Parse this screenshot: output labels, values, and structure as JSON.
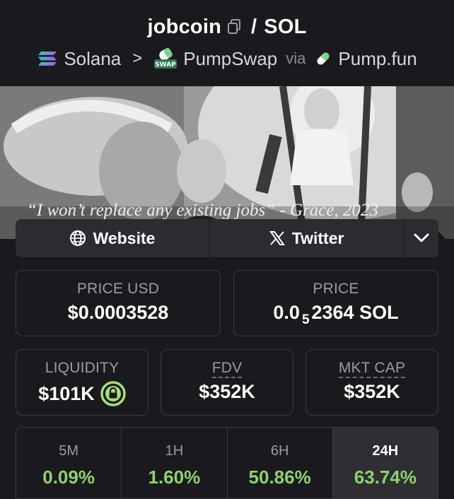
{
  "header": {
    "token": "jobcoin",
    "separator": "/",
    "quote": "SOL",
    "chain": "Solana",
    "chevron": ">",
    "dex": "PumpSwap",
    "dex_badge": "SWAP",
    "via": "via",
    "launchpad": "Pump.fun"
  },
  "banner": {
    "caption": "“I won’t replace any existing jobs” - Grace, 2023"
  },
  "links": {
    "website": "Website",
    "twitter": "Twitter"
  },
  "price_usd": {
    "label": "PRICE USD",
    "value": "$0.0003528"
  },
  "price_native": {
    "label": "PRICE",
    "prefix": "0.0",
    "subscript": "5",
    "suffix": "2364 SOL"
  },
  "liquidity": {
    "label": "LIQUIDITY",
    "value": "$101K"
  },
  "fdv": {
    "label": "FDV",
    "value": "$352K"
  },
  "mkt_cap": {
    "label": "MKT CAP",
    "value": "$352K"
  },
  "changes": [
    {
      "period": "5M",
      "value": "0.09%"
    },
    {
      "period": "1H",
      "value": "1.60%"
    },
    {
      "period": "6H",
      "value": "50.86%"
    },
    {
      "period": "24H",
      "value": "63.74%"
    }
  ],
  "active_period": "24H",
  "colors": {
    "background": "#1a1a1e",
    "positive": "#8fd16b",
    "card_border": "#3a3a40",
    "lock": "#a6e07a"
  }
}
